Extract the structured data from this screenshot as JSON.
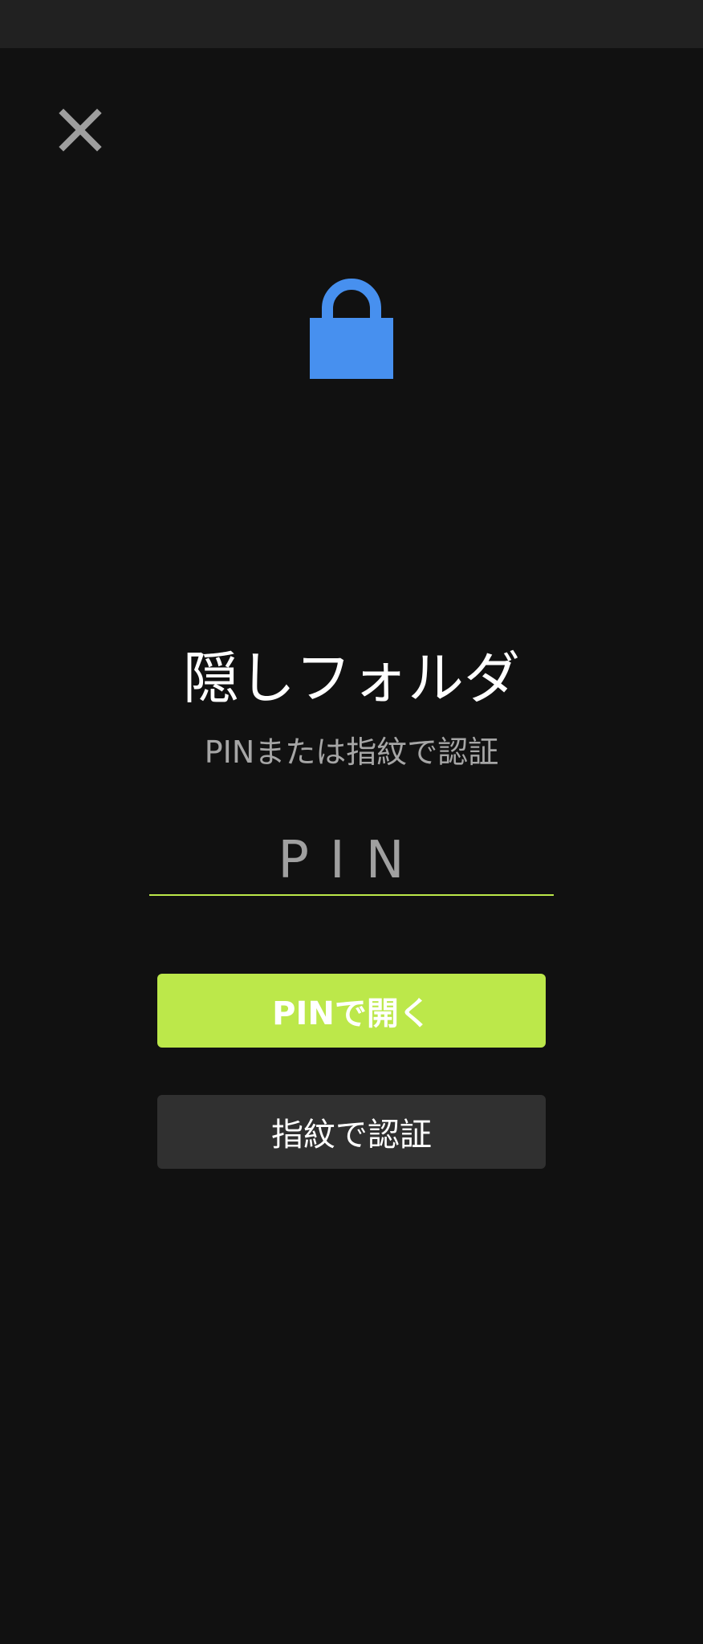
{
  "header": {
    "close_icon": "close-icon"
  },
  "lock": {
    "icon": "lock-icon",
    "color": "#4790ef"
  },
  "title": "隠しフォルダ",
  "subtitle": "PINまたは指紋で認証",
  "pin_field": {
    "value": "",
    "placeholder": "PIN"
  },
  "buttons": {
    "open_with_pin": "PINで開く",
    "fingerprint_auth": "指紋で認証"
  },
  "colors": {
    "background": "#111111",
    "accent": "#bce84a",
    "secondary_button": "#303030",
    "status_bar": "#212121"
  }
}
